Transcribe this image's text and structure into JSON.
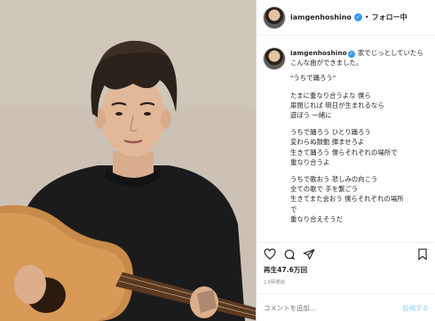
{
  "post": {
    "username": "iamgenhoshino",
    "follow_state": "フォロー中",
    "caption_intro": "家でじっとしていたらこんな曲ができました。",
    "song_title": "\"うちで踊ろう\"",
    "lyrics_stanza_1": [
      "たまに重なり合うよな 僕ら",
      "扉閉じれば 明日が生まれるなら",
      "遊ぼう 一緒に"
    ],
    "lyrics_stanza_2": [
      "うちで踊ろう ひとり踊ろう",
      "変わらぬ鼓動 弾ませろよ",
      "生きて踊ろう 僕らそれぞれの場所で",
      "重なり合うよ"
    ],
    "lyrics_stanza_3": [
      "うちで歌おう 悲しみの向こう",
      "全ての歌で 手を繋ごう",
      "生きてまた会おう 僕らそれぞれの場所",
      "で",
      "重なり合えそうだ"
    ],
    "views_text": "再生47.6万回",
    "timestamp": "13時間前",
    "comment_placeholder": "コメントを追加...",
    "post_button": "投稿する"
  },
  "icons": {
    "verified": "verified-badge-icon",
    "like": "heart-icon",
    "comment": "comment-bubble-icon",
    "share": "paper-plane-icon",
    "save": "bookmark-icon"
  },
  "colors": {
    "verified_blue": "#3897f0",
    "post_button_disabled": "#b2dffc",
    "muted_text": "#8e8e8e"
  }
}
